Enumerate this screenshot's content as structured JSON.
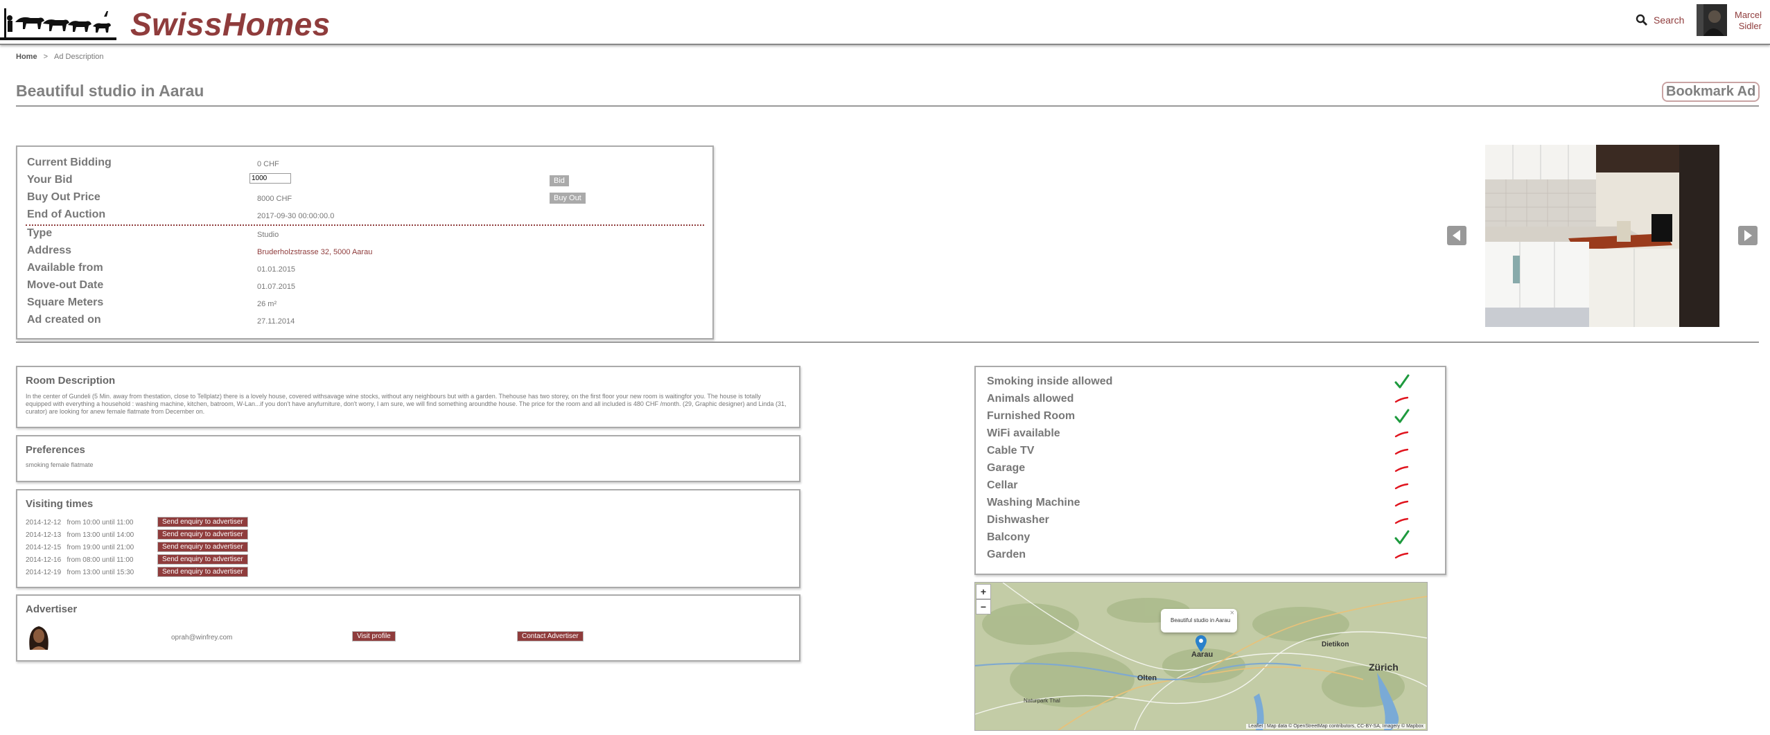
{
  "header": {
    "brand": "SwissHomes",
    "search_label": "Search",
    "user_name_line1": "Marcel",
    "user_name_line2": "Sidler"
  },
  "breadcrumb": {
    "home": "Home",
    "separator": ">",
    "current": "Ad Description"
  },
  "page": {
    "title": "Beautiful studio in Aarau",
    "bookmark_label": "Bookmark Ad"
  },
  "auction": {
    "rows": [
      {
        "label": "Current Bidding",
        "value": "0 CHF"
      },
      {
        "label": "Your Bid",
        "value": "1000"
      },
      {
        "label": "Buy Out Price",
        "value": "8000 CHF"
      },
      {
        "label": "End of Auction",
        "value": "2017-09-30 00:00:00.0"
      },
      {
        "label": "Type",
        "value": "Studio"
      },
      {
        "label": "Address",
        "value": "Bruderholzstrasse 32, 5000 Aarau"
      },
      {
        "label": "Available from",
        "value": "01.01.2015"
      },
      {
        "label": "Move-out Date",
        "value": "01.07.2015"
      },
      {
        "label": "Square Meters",
        "value": "26 m²"
      },
      {
        "label": "Ad created on",
        "value": "27.11.2014"
      }
    ],
    "bid_button": "Bid",
    "buyout_button": "Buy Out"
  },
  "room_description": {
    "title": "Room Description",
    "text": "In the center of Gundeli (5 Min. away from thestation, close to Tellplatz) there is a lovely house, covered withsavage wine stocks, without any neighbours but with a garden. Thehouse has two storey, on the first floor your new room is waitingfor you. The house is totally equipped with everything a household : washing machine, kitchen, batroom, W-Lan...if you don't have anyfurniture, don't worry, I am sure, we will find something aroundthe house. The price for the room and all included is 480 CHF /month. (29, Graphic designer) and Linda (31, curator) are looking for anew female flatmate from December on."
  },
  "preferences": {
    "title": "Preferences",
    "text": "smoking female flatmate"
  },
  "visiting": {
    "title": "Visiting times",
    "button_label": "Send enquiry to advertiser",
    "slots": [
      {
        "date": "2014-12-12",
        "time": "from 10:00 until 11:00"
      },
      {
        "date": "2014-12-13",
        "time": "from 13:00 until 14:00"
      },
      {
        "date": "2014-12-15",
        "time": "from 19:00 until 21:00"
      },
      {
        "date": "2014-12-16",
        "time": "from 08:00 until 11:00"
      },
      {
        "date": "2014-12-19",
        "time": "from 13:00 until 15:30"
      }
    ]
  },
  "advertiser": {
    "title": "Advertiser",
    "email": "oprah@winfrey.com",
    "visit_profile": "Visit profile",
    "contact": "Contact Advertiser"
  },
  "amenities": [
    {
      "label": "Smoking inside allowed",
      "available": true
    },
    {
      "label": "Animals allowed",
      "available": false
    },
    {
      "label": "Furnished Room",
      "available": true
    },
    {
      "label": "WiFi available",
      "available": false
    },
    {
      "label": "Cable TV",
      "available": false
    },
    {
      "label": "Garage",
      "available": false
    },
    {
      "label": "Cellar",
      "available": false
    },
    {
      "label": "Washing Machine",
      "available": false
    },
    {
      "label": "Dishwasher",
      "available": false
    },
    {
      "label": "Balcony",
      "available": true
    },
    {
      "label": "Garden",
      "available": false
    }
  ],
  "map": {
    "zoom_in": "+",
    "zoom_out": "−",
    "popup_text": "Beautiful studio in Aarau",
    "popup_close": "×",
    "labels": {
      "aarau": "Aarau",
      "olten": "Olten",
      "zurich": "Zürich",
      "dietikon": "Dietikon",
      "naturpark": "Naturpark Thal"
    },
    "attribution": "Leaflet | Map data © OpenStreetMap contributors, CC-BY-SA, Imagery © Mapbox"
  },
  "colors": {
    "brand": "#8f3c3c",
    "check": "#1e9a3e",
    "cross": "#e0141e"
  }
}
